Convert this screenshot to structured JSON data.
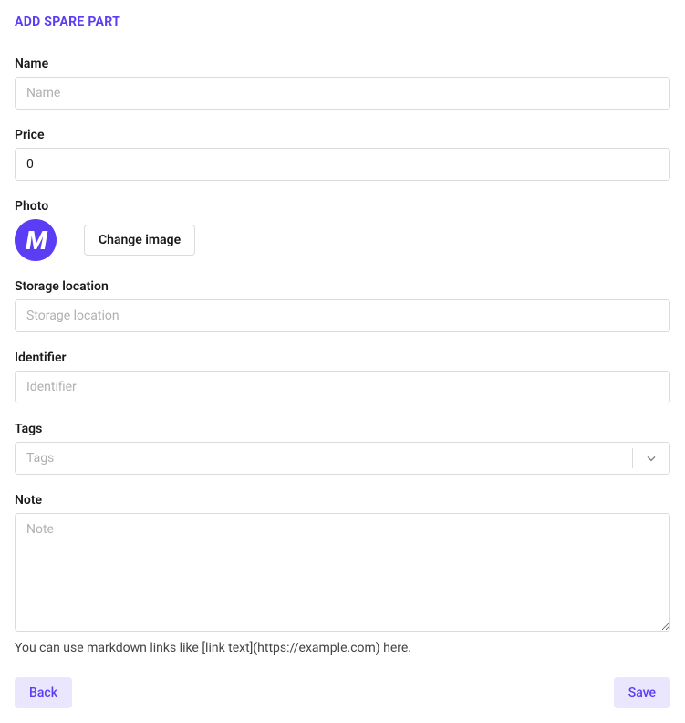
{
  "page": {
    "title": "ADD SPARE PART"
  },
  "form": {
    "name": {
      "label": "Name",
      "placeholder": "Name",
      "value": ""
    },
    "price": {
      "label": "Price",
      "value": "0"
    },
    "photo": {
      "label": "Photo",
      "avatar_letter": "M",
      "change_button": "Change image"
    },
    "storage_location": {
      "label": "Storage location",
      "placeholder": "Storage location",
      "value": ""
    },
    "identifier": {
      "label": "Identifier",
      "placeholder": "Identifier",
      "value": ""
    },
    "tags": {
      "label": "Tags",
      "placeholder": "Tags"
    },
    "note": {
      "label": "Note",
      "placeholder": "Note",
      "value": "",
      "help": "You can use markdown links like [link text](https://example.com) here."
    }
  },
  "buttons": {
    "back": "Back",
    "save": "Save"
  },
  "colors": {
    "accent": "#5b3df5",
    "accent_soft": "#eae6fd"
  }
}
